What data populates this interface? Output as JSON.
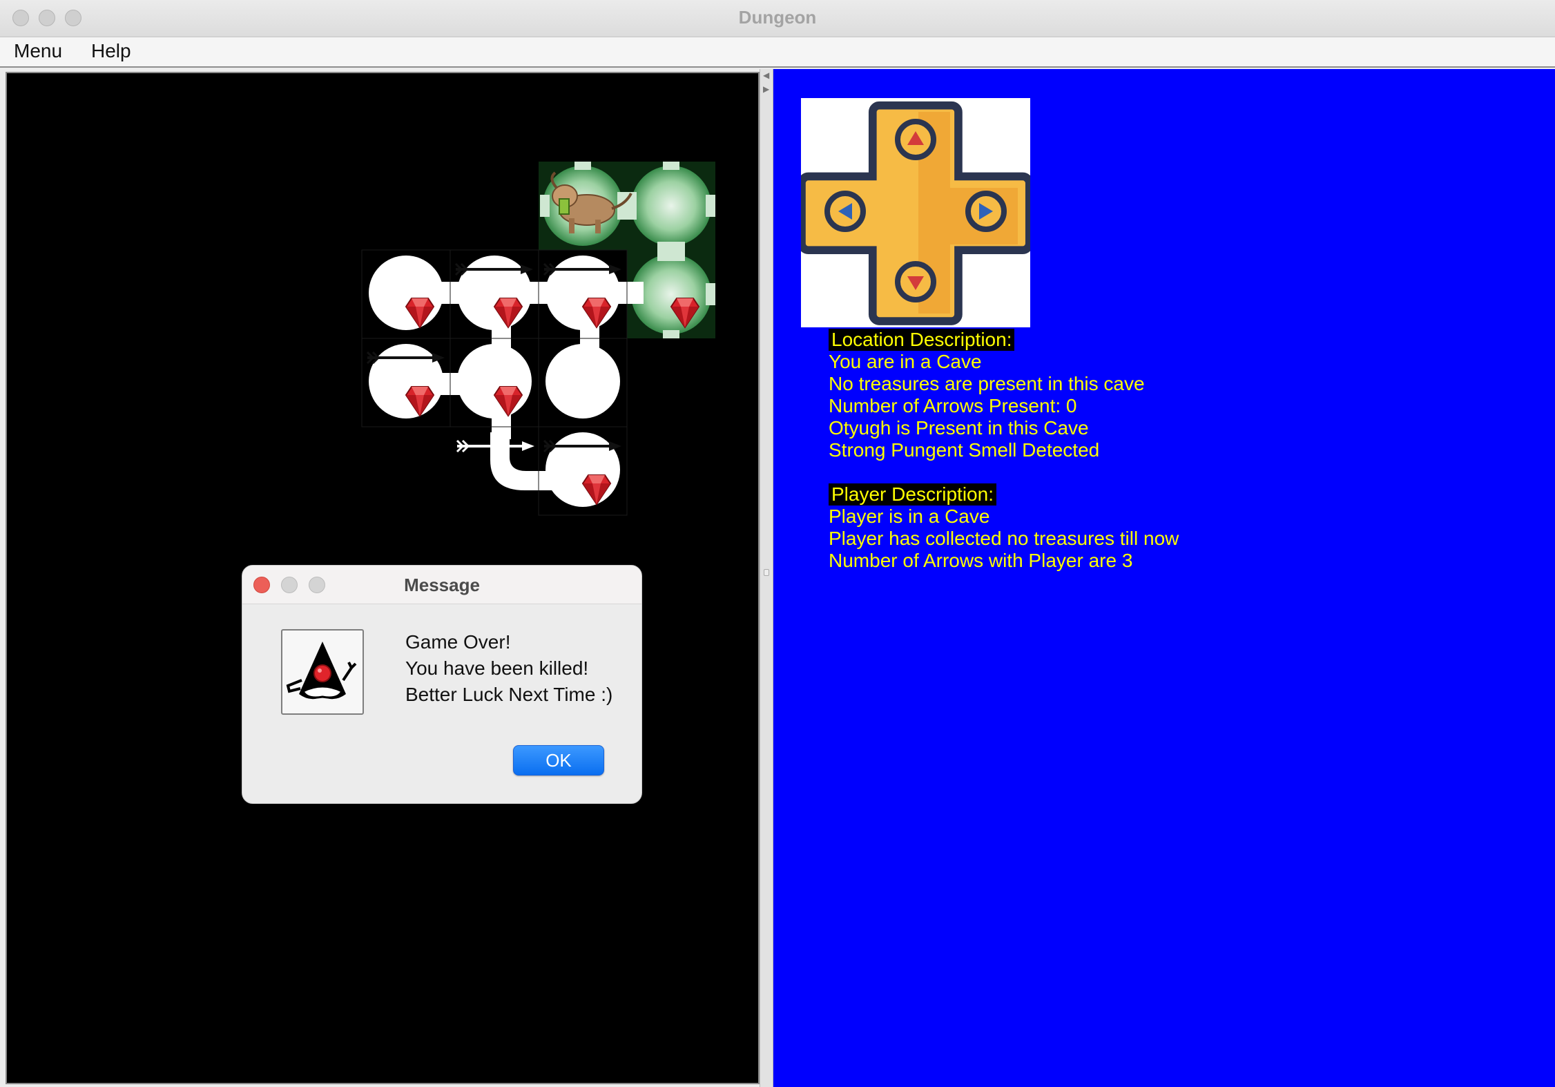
{
  "window": {
    "title": "Dungeon"
  },
  "menubar": {
    "items": [
      {
        "label": "Menu"
      },
      {
        "label": "Help"
      }
    ]
  },
  "location": {
    "header": "Location Description:",
    "lines": [
      "You are in a Cave",
      "No treasures are present in this cave",
      "Number of Arrows Present: 0",
      "Otyugh is Present in this Cave",
      "Strong Pungent Smell Detected"
    ]
  },
  "player": {
    "header": "Player Description:",
    "lines": [
      "Player is in a Cave",
      "Player has collected no treasures till now",
      "Number of Arrows with Player are 3"
    ]
  },
  "dialog": {
    "title": "Message",
    "lines": [
      "Game Over!",
      "You have been killed!",
      "Better Luck Next Time :)"
    ],
    "ok_label": "OK"
  },
  "colors": {
    "map_bg": "#000000",
    "info_bg": "#0000fe",
    "info_text": "#ffff00",
    "ruby": "#d8232a",
    "cave": "#ffffff",
    "explored_green": "#3e9a4c",
    "dpad_fill": "#f6bb45",
    "dpad_outline": "#2b3550",
    "dialog_close": "#ec5f58",
    "ok_button": "#1a7cf5"
  },
  "icons": {
    "dpad": "directional-pad-icon",
    "ruby": "ruby-gem-icon",
    "arrow": "arrow-icon",
    "monster": "otyugh-icon",
    "dialog": "java-duke-icon"
  }
}
